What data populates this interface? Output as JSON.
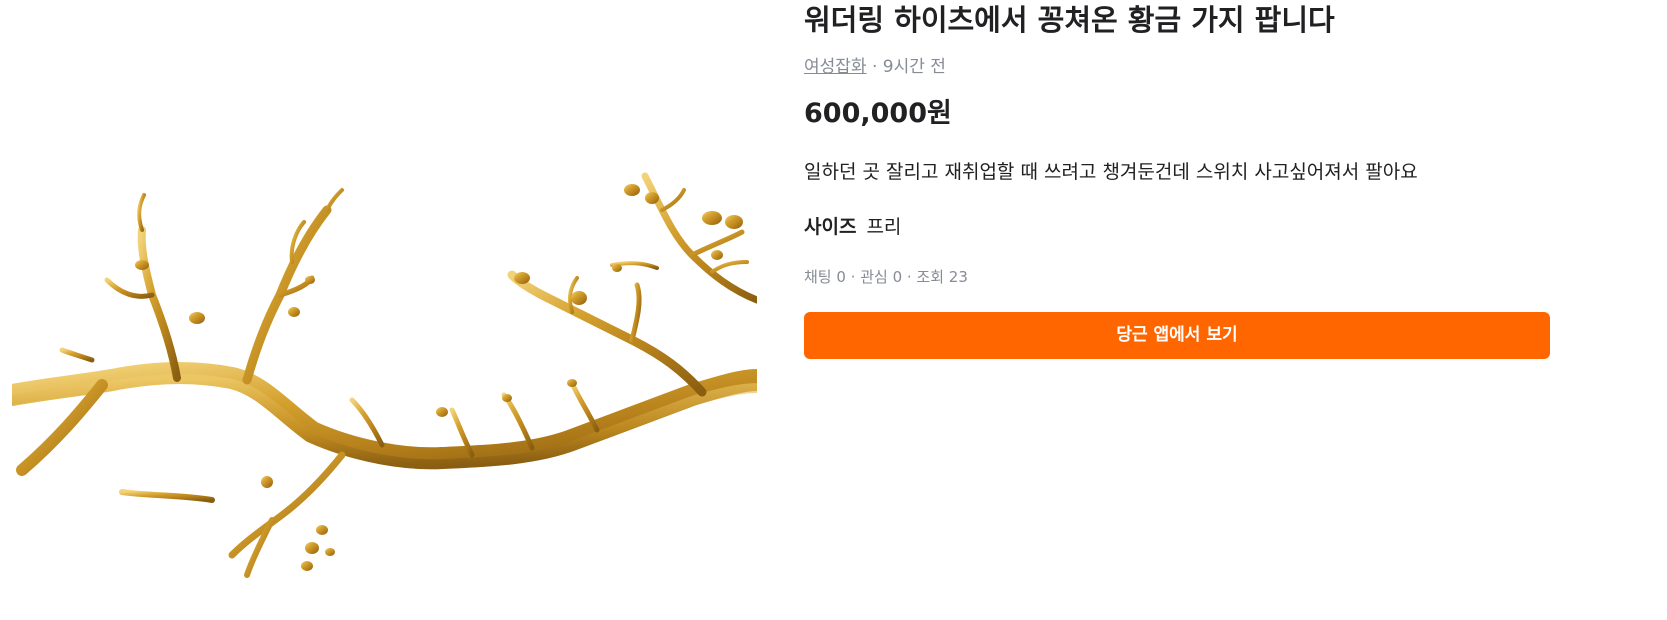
{
  "product": {
    "title": "워더링 하이츠에서 꽁쳐온 황금 가지 팝니다",
    "category": "여성잡화",
    "separator": " · ",
    "time_ago": "9시간 전",
    "price": "600,000원",
    "description": "일하던 곳 잘리고 재취업할 때 쓰려고 챙겨둔건데 스위치 사고싶어져서 팔아요",
    "size_label": "사이즈",
    "size_value": "프리",
    "stats": "채팅 0 · 관심 0 · 조회 23",
    "image_icon": "golden-branch-photo"
  },
  "cta": {
    "label": "당근 앱에서 보기",
    "color": "#ff6600"
  },
  "colors": {
    "text_primary": "#212124",
    "text_secondary": "#868b94",
    "gold": "#c9962a"
  }
}
